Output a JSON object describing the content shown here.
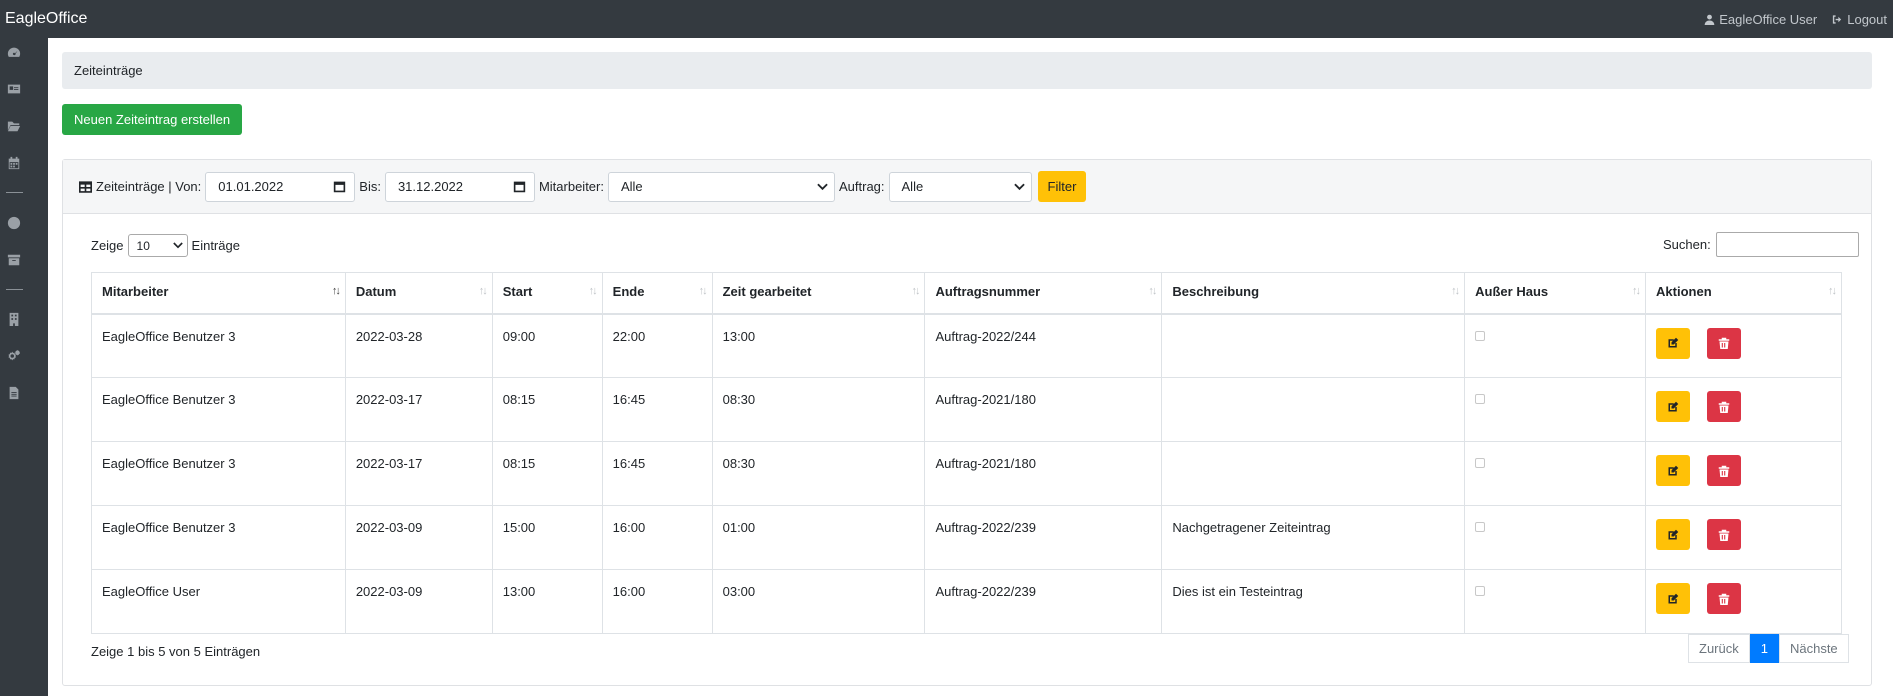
{
  "app": {
    "brand": "EagleOffice",
    "user": "EagleOffice User",
    "logout": "Logout"
  },
  "sidebar": {
    "icons": [
      "dashboard-icon",
      "id-card-icon",
      "folder-icon",
      "calendar-icon",
      "clock-icon",
      "archive-icon",
      "building-icon",
      "cogs-icon",
      "file-icon"
    ]
  },
  "page": {
    "breadcrumb": "Zeiteinträge",
    "create_button": "Neuen Zeiteintrag erstellen"
  },
  "filter": {
    "title": "Zeiteinträge | Von:",
    "from_value": "01.01.2022",
    "to_label": "Bis:",
    "to_value": "31.12.2022",
    "employee_label": "Mitarbeiter:",
    "employee_value": "Alle",
    "order_label": "Auftrag:",
    "order_value": "Alle",
    "filter_button": "Filter"
  },
  "table_controls": {
    "show_label": "Zeige",
    "page_length": "10",
    "entries_label": "Einträge",
    "search_label": "Suchen:"
  },
  "table": {
    "columns": [
      "Mitarbeiter",
      "Datum",
      "Start",
      "Ende",
      "Zeit gearbeitet",
      "Auftragsnummer",
      "Beschreibung",
      "Außer Haus",
      "Aktionen"
    ],
    "rows": [
      [
        "EagleOffice Benutzer 3",
        "2022-03-28",
        "09:00",
        "22:00",
        "13:00",
        "Auftrag-2022/244",
        ""
      ],
      [
        "EagleOffice Benutzer 3",
        "2022-03-17",
        "08:15",
        "16:45",
        "08:30",
        "Auftrag-2021/180",
        ""
      ],
      [
        "EagleOffice Benutzer 3",
        "2022-03-17",
        "08:15",
        "16:45",
        "08:30",
        "Auftrag-2021/180",
        ""
      ],
      [
        "EagleOffice Benutzer 3",
        "2022-03-09",
        "15:00",
        "16:00",
        "01:00",
        "Auftrag-2022/239",
        "Nachgetragener Zeiteintrag"
      ],
      [
        "EagleOffice User",
        "2022-03-09",
        "13:00",
        "16:00",
        "03:00",
        "Auftrag-2022/239",
        "Dies ist ein Testeintrag"
      ]
    ]
  },
  "footer": {
    "info": "Zeige 1 bis 5 von 5 Einträgen",
    "prev": "Zurück",
    "page": "1",
    "next": "Nächste"
  }
}
